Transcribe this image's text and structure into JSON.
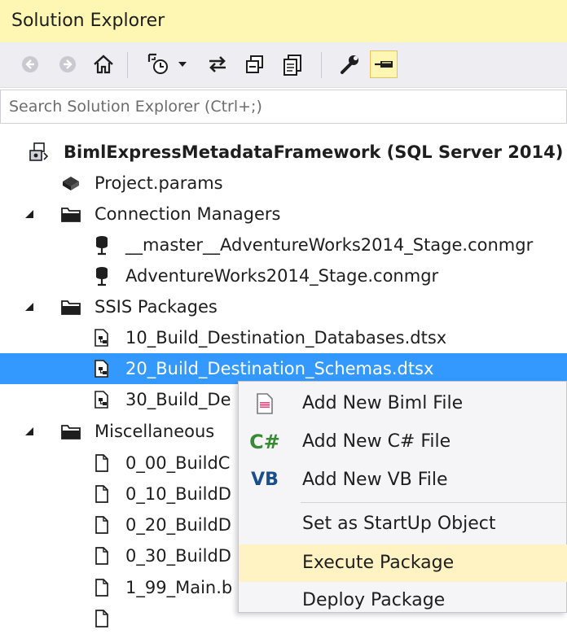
{
  "window": {
    "title": "Solution Explorer"
  },
  "toolbar": {
    "icons": [
      "back-icon",
      "forward-icon",
      "home-icon",
      "pending-changes-icon",
      "dropdown-arrow-icon",
      "sync-icon",
      "collapse-all-icon",
      "show-all-files-icon",
      "properties-icon",
      "pin-icon"
    ]
  },
  "search": {
    "placeholder": "Search Solution Explorer (Ctrl+;)"
  },
  "tree": {
    "project": "BimlExpressMetadataFramework (SQL Server 2014)",
    "project_params": "Project.params",
    "connection_managers": {
      "label": "Connection Managers",
      "items": [
        "__master__AdventureWorks2014_Stage.conmgr",
        "AdventureWorks2014_Stage.conmgr"
      ]
    },
    "ssis_packages": {
      "label": "SSIS Packages",
      "items": [
        "10_Build_Destination_Databases.dtsx",
        "20_Build_Destination_Schemas.dtsx",
        "30_Build_De"
      ],
      "selected_index": 1
    },
    "miscellaneous": {
      "label": "Miscellaneous",
      "items": [
        "0_00_BuildC",
        "0_10_BuildD",
        "0_20_BuildD",
        "0_30_BuildD",
        "1_99_Main.b"
      ]
    }
  },
  "context_menu": {
    "items": [
      {
        "icon": "biml-file-icon",
        "label": "Add New Biml File"
      },
      {
        "icon": "C#",
        "label": "Add New C# File"
      },
      {
        "icon": "VB",
        "label": "Add New VB File"
      },
      {
        "label": "Set as StartUp Object"
      },
      {
        "label": "Execute Package",
        "highlighted": true
      },
      {
        "label": "Deploy Package"
      }
    ]
  },
  "colors": {
    "title_bar_bg": "#fef7b3",
    "toolbar_bg": "#eeeef2",
    "selection_bg": "#3399ff",
    "menu_hover_bg": "#fff3c4",
    "csharp_green": "#388a34",
    "vb_blue": "#1a4f8a"
  }
}
